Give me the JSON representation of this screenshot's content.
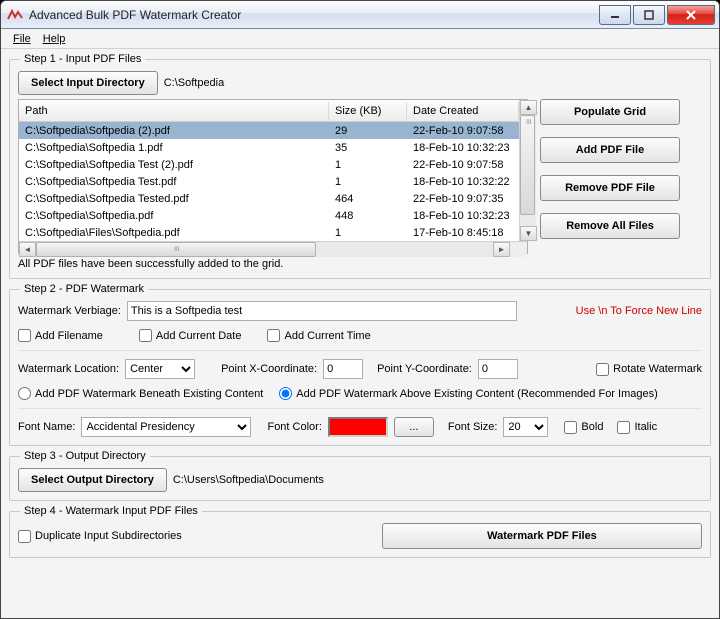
{
  "window": {
    "title": "Advanced Bulk PDF Watermark Creator"
  },
  "menu": {
    "file": "File",
    "help": "Help"
  },
  "step1": {
    "legend": "Step 1 - Input PDF Files",
    "select_btn": "Select Input Directory",
    "path": "C:\\Softpedia",
    "columns": {
      "path": "Path",
      "size": "Size (KB)",
      "date": "Date Created"
    },
    "rows": [
      {
        "path": "C:\\Softpedia\\Softpedia (2).pdf",
        "size": "29",
        "date": "22-Feb-10 9:07:58"
      },
      {
        "path": "C:\\Softpedia\\Softpedia 1.pdf",
        "size": "35",
        "date": "18-Feb-10 10:32:23"
      },
      {
        "path": "C:\\Softpedia\\Softpedia Test (2).pdf",
        "size": "1",
        "date": "22-Feb-10 9:07:58"
      },
      {
        "path": "C:\\Softpedia\\Softpedia Test.pdf",
        "size": "1",
        "date": "18-Feb-10 10:32:22"
      },
      {
        "path": "C:\\Softpedia\\Softpedia Tested.pdf",
        "size": "464",
        "date": "22-Feb-10 9:07:35"
      },
      {
        "path": "C:\\Softpedia\\Softpedia.pdf",
        "size": "448",
        "date": "18-Feb-10 10:32:23"
      },
      {
        "path": "C:\\Softpedia\\Files\\Softpedia.pdf",
        "size": "1",
        "date": "17-Feb-10 8:45:18"
      }
    ],
    "side": {
      "populate": "Populate Grid",
      "add": "Add PDF File",
      "remove": "Remove PDF File",
      "removeall": "Remove All Files"
    },
    "status": "All PDF files have been successfully added to the grid."
  },
  "step2": {
    "legend": "Step 2 - PDF Watermark",
    "verbiage_label": "Watermark Verbiage:",
    "verbiage_value": "This is a Softpedia test",
    "force_newline": "Use \\n To Force New Line",
    "add_filename": "Add Filename",
    "add_date": "Add Current Date",
    "add_time": "Add Current Time",
    "location_label": "Watermark Location:",
    "location_value": "Center",
    "px_label": "Point X-Coordinate:",
    "px_value": "0",
    "py_label": "Point Y-Coordinate:",
    "py_value": "0",
    "rotate": "Rotate Watermark",
    "beneath": "Add PDF Watermark Beneath Existing Content",
    "above": "Add PDF Watermark Above Existing Content (Recommended For Images)",
    "font_name_label": "Font Name:",
    "font_name_value": "Accidental Presidency",
    "font_color_label": "Font Color:",
    "font_color_hex": "#ff0000",
    "browse": "...",
    "font_size_label": "Font Size:",
    "font_size_value": "20",
    "bold": "Bold",
    "italic": "Italic"
  },
  "step3": {
    "legend": "Step 3 - Output Directory",
    "select_btn": "Select Output Directory",
    "path": "C:\\Users\\Softpedia\\Documents"
  },
  "step4": {
    "legend": "Step 4 - Watermark Input PDF Files",
    "duplicate": "Duplicate Input Subdirectories",
    "go": "Watermark PDF Files"
  }
}
